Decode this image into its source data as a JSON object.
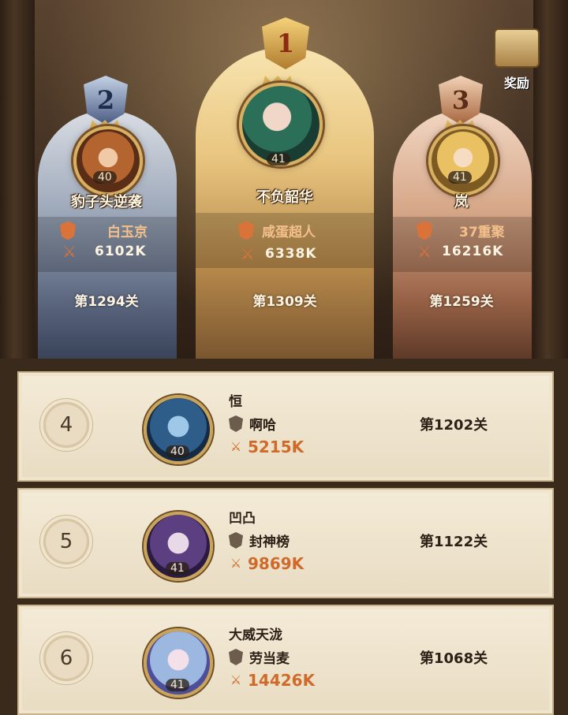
{
  "reward": {
    "label": "奖励"
  },
  "top3": [
    {
      "rank": "1",
      "level": "41",
      "name": "不负韶华",
      "guild": "咸蛋超人",
      "power": "6338K",
      "stage": "第1309关"
    },
    {
      "rank": "2",
      "level": "40",
      "name": "豹子头逆袭",
      "guild": "白玉京",
      "power": "6102K",
      "stage": "第1294关"
    },
    {
      "rank": "3",
      "level": "41",
      "name": "岚",
      "guild": "37重聚",
      "power": "16216K",
      "stage": "第1259关"
    }
  ],
  "list": [
    {
      "rank": "4",
      "level": "40",
      "name": "恒",
      "guild": "啊哈",
      "power": "5215K",
      "stage": "第1202关"
    },
    {
      "rank": "5",
      "level": "41",
      "name": "凹凸",
      "guild": "封神榜",
      "power": "9869K",
      "stage": "第1122关"
    },
    {
      "rank": "6",
      "level": "41",
      "name": "大威天泷",
      "guild": "劳当麦",
      "power": "14426K",
      "stage": "第1068关"
    }
  ],
  "colors": {
    "power_accent": "#d06a2a",
    "gold": "#d8b062"
  }
}
